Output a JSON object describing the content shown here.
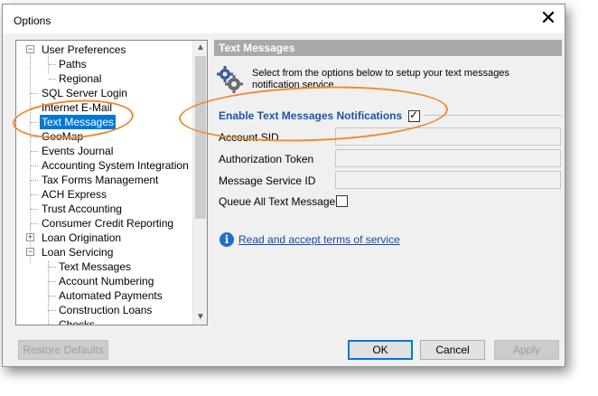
{
  "window": {
    "title": "Options",
    "close_glyph": "✕"
  },
  "tree": {
    "items": [
      {
        "label": "User Preferences",
        "level": 0,
        "expander": "⊟",
        "selected": false
      },
      {
        "label": "Paths",
        "level": 1,
        "selected": false
      },
      {
        "label": "Regional",
        "level": 1,
        "selected": false
      },
      {
        "label": "SQL Server Login",
        "level": 0,
        "selected": false
      },
      {
        "label": "Internet E-Mail",
        "level": 0,
        "selected": false
      },
      {
        "label": "Text Messages",
        "level": 0,
        "selected": true
      },
      {
        "label": "GeoMap",
        "level": 0,
        "selected": false
      },
      {
        "label": "Events Journal",
        "level": 0,
        "selected": false
      },
      {
        "label": "Accounting System Integration",
        "level": 0,
        "selected": false
      },
      {
        "label": "Tax Forms Management",
        "level": 0,
        "selected": false
      },
      {
        "label": "ACH Express",
        "level": 0,
        "selected": false
      },
      {
        "label": "Trust Accounting",
        "level": 0,
        "selected": false
      },
      {
        "label": "Consumer Credit Reporting",
        "level": 0,
        "selected": false
      },
      {
        "label": "Loan Origination",
        "level": 0,
        "expander": "⊞",
        "selected": false
      },
      {
        "label": "Loan Servicing",
        "level": 0,
        "expander": "⊟",
        "selected": false
      },
      {
        "label": "Text Messages",
        "level": 1,
        "selected": false
      },
      {
        "label": "Account Numbering",
        "level": 1,
        "selected": false
      },
      {
        "label": "Automated Payments",
        "level": 1,
        "selected": false
      },
      {
        "label": "Construction Loans",
        "level": 1,
        "selected": false
      },
      {
        "label": "Checks",
        "level": 1,
        "selected": false
      }
    ],
    "scroll_up_glyph": "▲",
    "scroll_down_glyph": "▼"
  },
  "panel": {
    "header": "Text Messages",
    "intro": "Select from the options below to setup your text messages notification service.",
    "enable_label": "Enable Text Messages Notifications",
    "enable_checked": true,
    "fields": [
      {
        "label": "Account SID",
        "value": ""
      },
      {
        "label": "Authorization Token",
        "value": ""
      },
      {
        "label": "Message Service ID",
        "value": ""
      }
    ],
    "queue_label": "Queue All Text Messages",
    "queue_checked": false,
    "info_glyph": "i",
    "terms_link": "Read and accept terms of service"
  },
  "buttons": {
    "restore_defaults": "Restore Defaults",
    "ok": "OK",
    "cancel": "Cancel",
    "apply": "Apply"
  },
  "icons": {
    "gear": "gear-icon",
    "info": "info-icon",
    "close": "close-icon",
    "checkmark": "✓"
  },
  "colors": {
    "selection": "#0078d7",
    "section_header": "#a9a9a9",
    "enable_label": "#1c55a6",
    "link": "#1a47a8",
    "annotation": "#ef8a2e"
  }
}
